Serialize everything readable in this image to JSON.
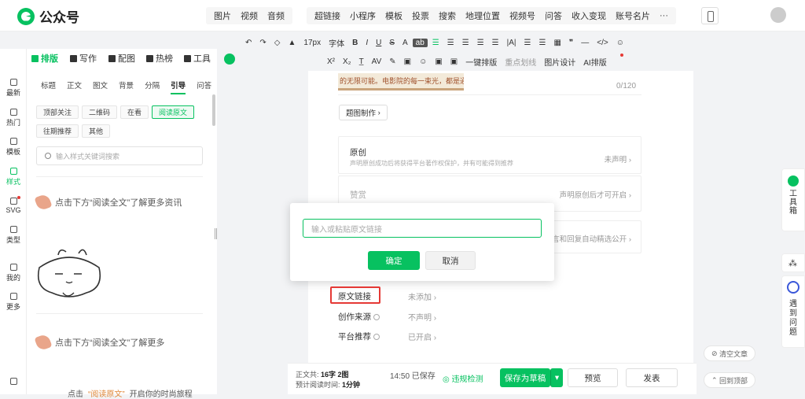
{
  "app": {
    "name": "公众号"
  },
  "topmenu": {
    "group1": [
      "图片",
      "视频",
      "音频"
    ],
    "group2": [
      "超链接",
      "小程序",
      "模板",
      "投票",
      "搜索",
      "地理位置",
      "视频号",
      "问答",
      "收入变现",
      "账号名片",
      "···"
    ]
  },
  "toolbar": {
    "row1": [
      "↶",
      "↷",
      "◇",
      "▲",
      "17px",
      "字体",
      "B",
      "I",
      "U",
      "S",
      "A",
      "ab",
      "☰",
      "☰",
      "☰",
      "☰",
      "☰",
      "|A|",
      "☰",
      "☰",
      "▦",
      "❞",
      "—",
      "</>",
      "☺"
    ],
    "row2": [
      "X²",
      "X₂",
      "T̲",
      "AV",
      "✎",
      "▣",
      "☺",
      "▣",
      "▣",
      "一键排版",
      "重点划线",
      "图片设计",
      "AI排版"
    ]
  },
  "left_tabs": {
    "active": "排版",
    "items": [
      "排版",
      "写作",
      "配图",
      "热榜",
      "工具"
    ]
  },
  "sidenav": [
    "最新",
    "热门",
    "模板",
    "样式",
    "SVG",
    "类型",
    "我的",
    "更多"
  ],
  "style_tabs": [
    "标题",
    "正文",
    "图文",
    "背景",
    "分隔",
    "引导",
    "问答"
  ],
  "chips": {
    "row1": [
      "顶部关注",
      "二维码",
      "在看",
      "阅读原文"
    ],
    "row2": [
      "往期推荐",
      "其他"
    ]
  },
  "search": {
    "placeholder": "输入样式关键词搜索"
  },
  "templates": {
    "t1": "点击下方“阅读全文”了解更多资讯",
    "t2": "点击下方“阅读全文”了解更多",
    "t3_a": "点击",
    "t3_b": "“阅读原文”",
    "t3_c": "开启你的时尚旅程"
  },
  "editor": {
    "snippet": "的无限可能。电影院的每一束光，都是通往",
    "count": "0/120",
    "topic_btn": "题图制作",
    "original": {
      "title": "原创",
      "desc": "声明原创成功后将获得平台著作权保护，并有可能得到推荐",
      "value": "未声明"
    },
    "reward": {
      "title": "赞赏",
      "value": "声明原创后才可开启"
    },
    "comment": {
      "value": "言和回复自动精选公开"
    },
    "options": [
      {
        "label": "原文链接",
        "value": "未添加"
      },
      {
        "label": "创作来源",
        "value": "不声明"
      },
      {
        "label": "平台推荐",
        "value": "已开启"
      }
    ]
  },
  "modal": {
    "placeholder": "输入或粘贴原文链接",
    "ok": "确定",
    "cancel": "取消"
  },
  "footer": {
    "wordcount_label": "正文共:",
    "wordcount_value": "16字 2图",
    "readtime_label": "预计阅读时间:",
    "readtime_value": "1分钟",
    "saved": "14:50 已保存",
    "safe": "违规检测",
    "save": "保存为草稿",
    "preview": "预览",
    "publish": "发表"
  },
  "right": {
    "toolbox": "工具箱",
    "help": "遇到问题",
    "clear": "清空文章",
    "top": "回到顶部"
  }
}
